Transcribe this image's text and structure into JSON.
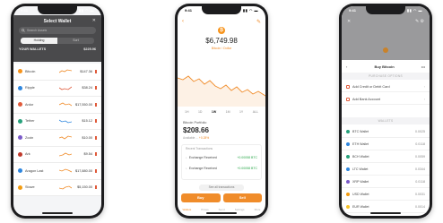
{
  "phone1": {
    "status": {
      "time": "9:41",
      "icons": "▮▮ ◠ ▬"
    },
    "title": "Select Wallet",
    "close_glyph": "✕",
    "search_placeholder": "Search Assets",
    "tabs": [
      "Holding",
      "Sort"
    ],
    "section_label": "YOUR WALLETS",
    "section_total": "$225.96",
    "wallets": [
      {
        "name": "Bitcoin",
        "value": "$147.36",
        "color": "#f7931a",
        "spark_color": "#f08c2a"
      },
      {
        "name": "Ripple",
        "value": "$38.24",
        "color": "#2e86de",
        "spark_color": "#e05a3a"
      },
      {
        "name": "Ardor",
        "value": "$17,550.00",
        "color": "#e05a3a",
        "spark_color": "#f08c2a"
      },
      {
        "name": "Tether",
        "value": "$15.12",
        "color": "#26a17b",
        "spark_color": "#2e86de"
      },
      {
        "name": "Zcoin",
        "value": "$10.00",
        "color": "#7a5ac8",
        "spark_color": "#f08c2a"
      },
      {
        "name": "Ark",
        "value": "$9.54",
        "color": "#c0392b",
        "spark_color": "#f08c2a"
      },
      {
        "name": "Aragon Last",
        "value": "$17,880.00",
        "color": "#2e86de",
        "spark_color": "#f08c2a"
      },
      {
        "name": "Stowe",
        "value": "$5,150.00",
        "color": "#f39c12",
        "spark_color": "#f08c2a"
      }
    ]
  },
  "phone2": {
    "status": {
      "time": "9:41",
      "icons": "▮▮ ◠ ▬"
    },
    "back_glyph": "‹",
    "action_glyph": "✎",
    "coin_glyph": "₿",
    "price": "$6,749.98",
    "price_sub": "Bitcoin / Dollar",
    "periods": [
      "1H",
      "1D",
      "1W",
      "1M",
      "1Y",
      "ALL"
    ],
    "active_period": "1W",
    "balance_label": "Bitcoin Portfolio",
    "balance": "$208.66",
    "balance_sub": "Available ...",
    "balance_change": "+0.28%",
    "tx_header": "Recent Transactions",
    "transactions": [
      {
        "label": "Exchange Received",
        "amount": "+0.00058 BTC"
      },
      {
        "label": "Exchange Received",
        "amount": "+0.00058 BTC"
      }
    ],
    "see_all": "See all transactions",
    "buy_label": "Buy",
    "sell_label": "Sell",
    "tabs": [
      "Wallets",
      "Prices",
      "Send",
      "Settings",
      "More"
    ],
    "active_tab": "Wallets",
    "chart_color": "#f08c2a"
  },
  "phone3": {
    "status": {
      "time": "9:41",
      "icons": "▮▮ ◠ ▬"
    },
    "top_close": "✕",
    "top_actions": "✎ ⚙",
    "back_glyph": "‹",
    "title": "Buy Bitcoin",
    "more_glyph": "•••",
    "section_actions": "PURCHASE OPTIONS",
    "actions": [
      "Add Credit or Debit Card",
      "Add Bank Account"
    ],
    "chevron": "›",
    "section_wallets": "WALLETS",
    "wallets": [
      {
        "name": "BTC Wallet",
        "amount": "0.0025",
        "color": "#26a17b"
      },
      {
        "name": "ETH Wallet",
        "amount": "0.0118",
        "color": "#2e86de"
      },
      {
        "name": "BCH Wallet",
        "amount": "0.0059",
        "color": "#26a17b"
      },
      {
        "name": "LTC Wallet",
        "amount": "0.0344",
        "color": "#2e86de"
      },
      {
        "name": "XRP Wallet",
        "amount": "0.0118",
        "color": "#7a5ac8"
      },
      {
        "name": "USD Wallet",
        "amount": "0.0031",
        "color": "#f39c12"
      },
      {
        "name": "EUR Wallet",
        "amount": "0.0014",
        "color": "#f7c32a"
      }
    ]
  }
}
